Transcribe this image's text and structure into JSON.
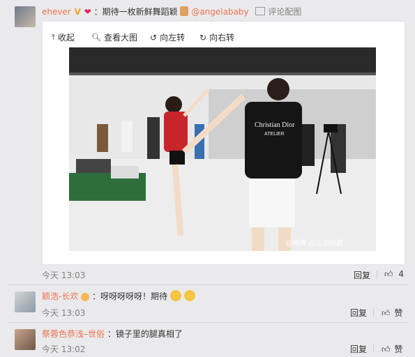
{
  "post": {
    "author": "ehever",
    "text": "：期待一枚新鲜舞蹈颖",
    "mention": "@angelababy",
    "reply_with_image": "评论配图",
    "time": "今天 13:03",
    "reply": "回复",
    "likes": "4"
  },
  "toolbar": {
    "collapse": "收起",
    "view_large": "查看大图",
    "rotate_left": "向左转",
    "rotate_right": "向右转"
  },
  "photo": {
    "shirt_brand": "Christian Dior",
    "shirt_sub": "ATELIER",
    "watermark": "@微博 @让胡晓歌"
  },
  "comments": [
    {
      "author": "颖浩-长欢",
      "text": "：呀呀呀呀呀！期待",
      "time": "今天 13:03",
      "reply": "回复",
      "like": "赞"
    },
    {
      "author": "祭蓉色恭浅–世俗",
      "text": "：镜子里的腿真相了",
      "time": "今天 13:02",
      "reply": "回复",
      "like": "赞"
    }
  ],
  "colors": {
    "accent": "#eb7350",
    "panel": "#ffffff",
    "page": "#eaeaec"
  }
}
